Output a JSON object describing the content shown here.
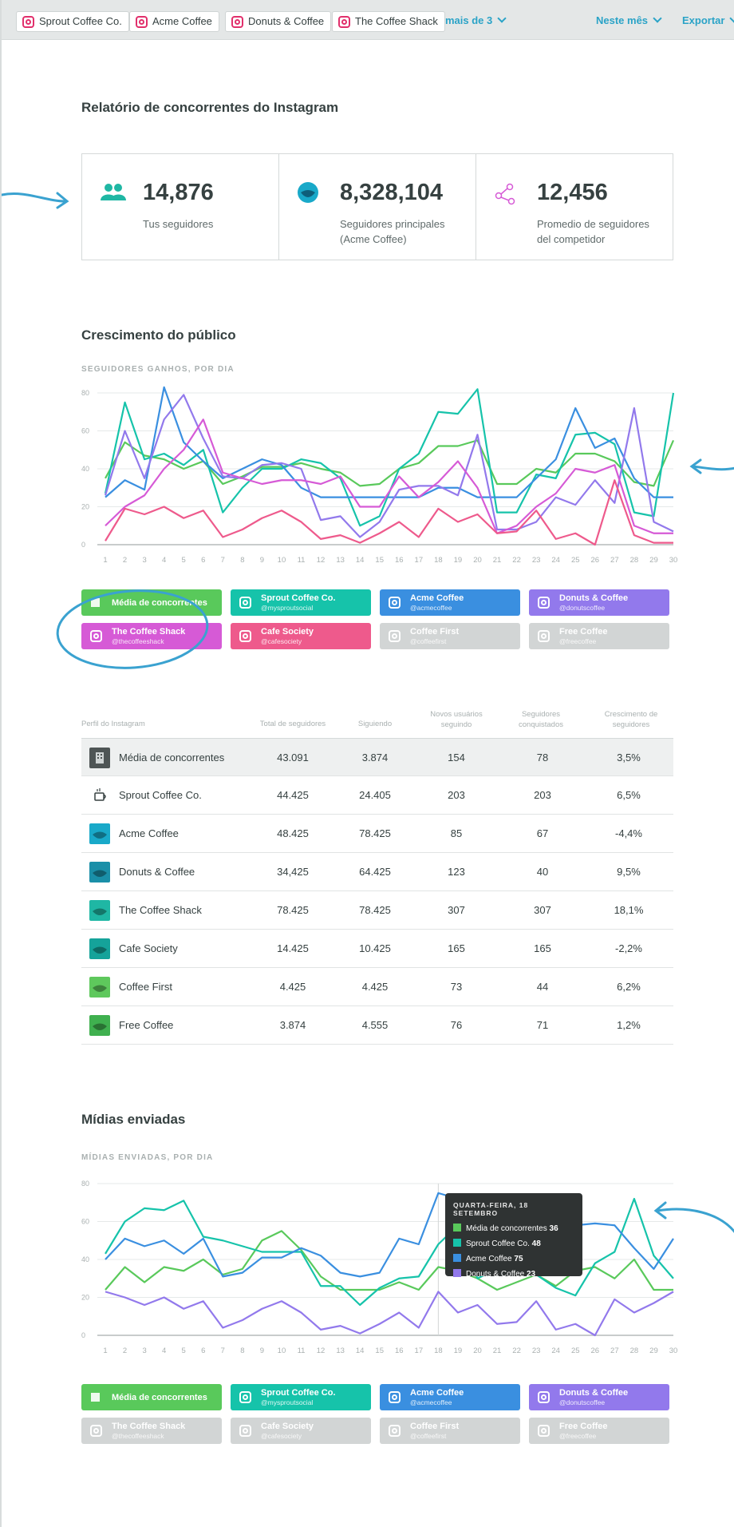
{
  "topbar": {
    "profiles": [
      "Sprout Coffee Co.",
      "Acme Coffee",
      "Donuts & Coffee",
      "The Coffee Shack"
    ],
    "more": "mais de 3",
    "period": "Neste mês",
    "export": "Exportar"
  },
  "report_title": "Relatório de concorrentes do Instagram",
  "stats": [
    {
      "value": "14,876",
      "label_1": "Tus seguidores",
      "label_2": "",
      "icon": "people-icon"
    },
    {
      "value": "8,328,104",
      "label_1": "Seguidores principales",
      "label_2": "(Acme Coffee)",
      "icon": "coffee-avatar-icon"
    },
    {
      "value": "12,456",
      "label_1": "Promedio de seguidores",
      "label_2": "del competidor",
      "icon": "network-icon"
    }
  ],
  "growth": {
    "title": "Crescimento do público",
    "subtitle": "SEGUIDORES GANHOS, POR DIA"
  },
  "legend": [
    {
      "name": "Média de concorrentes",
      "handle": "",
      "color": "#59c95b",
      "active": true
    },
    {
      "name": "Sprout Coffee Co.",
      "handle": "@mysproutsocial",
      "color": "#16c3aa",
      "active": true
    },
    {
      "name": "Acme Coffee",
      "handle": "@acmecoffee",
      "color": "#3a8fe0",
      "active": true
    },
    {
      "name": "Donuts & Coffee",
      "handle": "@donutscoffee",
      "color": "#9279ec",
      "active": true
    },
    {
      "name": "The Coffee Shack",
      "handle": "@thecoffeeshack",
      "color": "#d65ad6",
      "active": true
    },
    {
      "name": "Cafe Society",
      "handle": "@cafesociety",
      "color": "#ee5a8c",
      "active": true
    },
    {
      "name": "Coffee First",
      "handle": "@coffeefirst",
      "color": "#d2d5d5",
      "active": false
    },
    {
      "name": "Free Coffee",
      "handle": "@freecoffee",
      "color": "#d2d5d5",
      "active": false
    }
  ],
  "legend2": [
    {
      "name": "Média de concorrentes",
      "handle": "",
      "color": "#59c95b",
      "active": true
    },
    {
      "name": "Sprout Coffee Co.",
      "handle": "@mysproutsocial",
      "color": "#16c3aa",
      "active": true
    },
    {
      "name": "Acme Coffee",
      "handle": "@acmecoffee",
      "color": "#3a8fe0",
      "active": true
    },
    {
      "name": "Donuts & Coffee",
      "handle": "@donutscoffee",
      "color": "#9279ec",
      "active": true
    },
    {
      "name": "The Coffee Shack",
      "handle": "@thecoffeeshack",
      "color": "#d2d5d5",
      "active": false
    },
    {
      "name": "Cafe Society",
      "handle": "@cafesociety",
      "color": "#d2d5d5",
      "active": false
    },
    {
      "name": "Coffee First",
      "handle": "@coffeefirst",
      "color": "#d2d5d5",
      "active": false
    },
    {
      "name": "Free Coffee",
      "handle": "@freecoffee",
      "color": "#d2d5d5",
      "active": false
    }
  ],
  "table": {
    "headers": [
      "Perfil do Instagram",
      "Total de seguidores",
      "Siguiendo",
      "Novos usuários seguindo",
      "Seguidores conquistados",
      "Crescimento de seguidores"
    ],
    "rows": [
      {
        "name": "Média de concorrentes",
        "total": "43.091",
        "following": "3.874",
        "new_following": "154",
        "gained": "78",
        "growth": "3,5%"
      },
      {
        "name": "Sprout Coffee Co.",
        "total": "44.425",
        "following": "24.405",
        "new_following": "203",
        "gained": "203",
        "growth": "6,5%"
      },
      {
        "name": "Acme Coffee",
        "total": "48.425",
        "following": "78.425",
        "new_following": "85",
        "gained": "67",
        "growth": "-4,4%"
      },
      {
        "name": "Donuts & Coffee",
        "total": "34,425",
        "following": "64.425",
        "new_following": "123",
        "gained": "40",
        "growth": "9,5%"
      },
      {
        "name": "The Coffee Shack",
        "total": "78.425",
        "following": "78.425",
        "new_following": "307",
        "gained": "307",
        "growth": "18,1%"
      },
      {
        "name": "Cafe Society",
        "total": "14.425",
        "following": "10.425",
        "new_following": "165",
        "gained": "165",
        "growth": "-2,2%"
      },
      {
        "name": "Coffee First",
        "total": "4.425",
        "following": "4.425",
        "new_following": "73",
        "gained": "44",
        "growth": "6,2%"
      },
      {
        "name": "Free Coffee",
        "total": "3.874",
        "following": "4.555",
        "new_following": "76",
        "gained": "71",
        "growth": "1,2%"
      }
    ]
  },
  "media": {
    "title": "Mídias enviadas",
    "subtitle": "MÍDIAS ENVIADAS, POR DIA",
    "tooltip": {
      "date": "QUARTA-FEIRA, 18 SETEMBRO",
      "lines": [
        {
          "label": "Média de concorrentes",
          "value": "36",
          "color": "#59c95b"
        },
        {
          "label": "Sprout Coffee Co.",
          "value": "48",
          "color": "#16c3aa"
        },
        {
          "label": "Acme Coffee",
          "value": "75",
          "color": "#3a8fe0"
        },
        {
          "label": "Donuts & Coffee",
          "value": "23",
          "color": "#9279ec"
        }
      ]
    }
  },
  "chart_data": [
    {
      "type": "line",
      "title": "Crescimento do público",
      "subtitle": "SEGUIDORES GANHOS, POR DIA",
      "ylim": [
        0,
        80
      ],
      "yticks": [
        0,
        20,
        40,
        60,
        80
      ],
      "x": [
        1,
        2,
        3,
        4,
        5,
        6,
        7,
        8,
        9,
        10,
        11,
        12,
        13,
        14,
        15,
        16,
        17,
        18,
        19,
        20,
        21,
        22,
        23,
        24,
        25,
        26,
        27,
        28,
        29,
        30
      ],
      "series": [
        {
          "name": "Média de concorrentes",
          "color": "#59c95b",
          "values": [
            35,
            54,
            47,
            45,
            40,
            44,
            32,
            36,
            41,
            41,
            43,
            40,
            38,
            31,
            32,
            40,
            43,
            52,
            52,
            55,
            32,
            32,
            40,
            38,
            48,
            48,
            44,
            33,
            31,
            55
          ]
        },
        {
          "name": "Sprout Coffee Co.",
          "color": "#16c3aa",
          "values": [
            27,
            75,
            45,
            48,
            42,
            50,
            17,
            30,
            40,
            40,
            45,
            43,
            35,
            10,
            15,
            40,
            48,
            70,
            69,
            82,
            17,
            17,
            37,
            35,
            58,
            59,
            53,
            17,
            15,
            80
          ]
        },
        {
          "name": "Acme Coffee",
          "color": "#3a8fe0",
          "values": [
            25,
            34,
            29,
            83,
            54,
            44,
            35,
            40,
            45,
            42,
            30,
            25,
            25,
            25,
            25,
            25,
            25,
            30,
            30,
            25,
            25,
            25,
            35,
            45,
            72,
            51,
            56,
            35,
            25,
            25
          ]
        },
        {
          "name": "Donuts & Coffee",
          "color": "#9279ec",
          "values": [
            26,
            60,
            35,
            66,
            79,
            56,
            36,
            35,
            42,
            43,
            40,
            13,
            15,
            4,
            12,
            29,
            31,
            31,
            26,
            58,
            8,
            8,
            12,
            25,
            21,
            34,
            22,
            72,
            12,
            7
          ]
        },
        {
          "name": "The Coffee Shack",
          "color": "#d65ad6",
          "values": [
            10,
            20,
            26,
            40,
            50,
            66,
            38,
            35,
            32,
            34,
            34,
            32,
            36,
            20,
            20,
            36,
            25,
            33,
            44,
            30,
            6,
            10,
            20,
            27,
            40,
            38,
            42,
            10,
            6,
            6
          ]
        },
        {
          "name": "Cafe Society",
          "color": "#ee5a8c",
          "values": [
            2,
            19,
            16,
            20,
            14,
            18,
            4,
            8,
            14,
            18,
            12,
            3,
            5,
            1,
            6,
            12,
            4,
            19,
            12,
            16,
            6,
            7,
            18,
            3,
            6,
            0,
            34,
            5,
            1,
            1
          ]
        }
      ]
    },
    {
      "type": "line",
      "title": "Mídias enviadas",
      "subtitle": "MÍDIAS ENVIADAS, POR DIA",
      "ylim": [
        0,
        80
      ],
      "yticks": [
        0,
        20,
        40,
        60,
        80
      ],
      "x": [
        1,
        2,
        3,
        4,
        5,
        6,
        7,
        8,
        9,
        10,
        11,
        12,
        13,
        14,
        15,
        16,
        17,
        18,
        19,
        20,
        21,
        22,
        23,
        24,
        25,
        26,
        27,
        28,
        29,
        30
      ],
      "series": [
        {
          "name": "Média de concorrentes",
          "color": "#59c95b",
          "values": [
            24,
            36,
            28,
            36,
            34,
            40,
            32,
            35,
            50,
            55,
            45,
            31,
            24,
            24,
            24,
            28,
            24,
            36,
            34,
            30,
            24,
            28,
            32,
            26,
            34,
            36,
            30,
            40,
            24,
            24
          ]
        },
        {
          "name": "Sprout Coffee Co.",
          "color": "#16c3aa",
          "values": [
            43,
            60,
            67,
            66,
            71,
            52,
            50,
            47,
            44,
            44,
            44,
            26,
            26,
            16,
            25,
            30,
            31,
            48,
            58,
            30,
            35,
            35,
            32,
            25,
            21,
            38,
            44,
            72,
            42,
            30
          ]
        },
        {
          "name": "Acme Coffee",
          "color": "#3a8fe0",
          "values": [
            40,
            51,
            47,
            50,
            43,
            51,
            31,
            33,
            41,
            41,
            46,
            42,
            33,
            31,
            33,
            51,
            48,
            75,
            72,
            68,
            50,
            40,
            35,
            36,
            58,
            59,
            58,
            46,
            35,
            51
          ]
        },
        {
          "name": "Donuts & Coffee",
          "color": "#9279ec",
          "values": [
            23,
            20,
            16,
            20,
            14,
            18,
            4,
            8,
            14,
            18,
            12,
            3,
            5,
            1,
            6,
            12,
            4,
            23,
            12,
            16,
            6,
            7,
            18,
            3,
            6,
            0,
            19,
            12,
            17,
            23
          ]
        }
      ]
    }
  ]
}
